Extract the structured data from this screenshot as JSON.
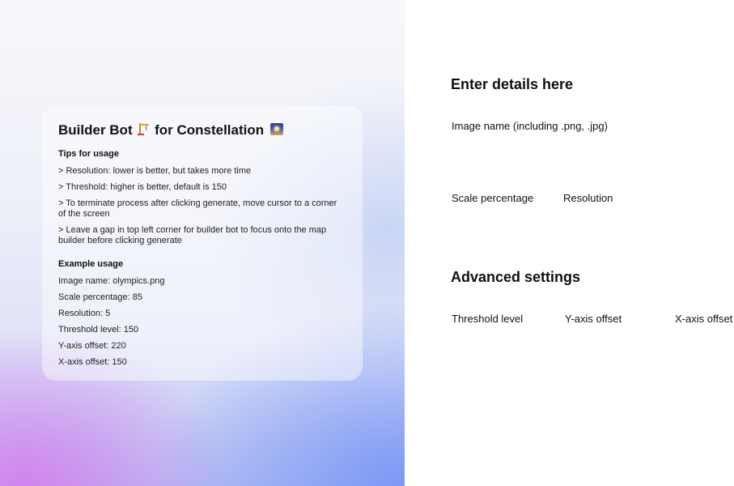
{
  "info": {
    "title_prefix": "Builder Bot",
    "title_suffix": "for Constellation",
    "tips_heading": "Tips for usage",
    "tips": [
      "> Resolution: lower is better, but takes more time",
      "> Threshold: higher is better, default is 150",
      "> To terminate process after clicking generate, move cursor to a corner of the screen",
      "> Leave a gap in top left corner for builder bot to focus onto the map builder before clicking generate"
    ],
    "example_heading": "Example usage",
    "examples": [
      "Image name: olympics.png",
      "Scale percentage: 85",
      "Resolution: 5",
      "Threshold level: 150",
      "Y-axis offset: 220",
      "X-axis offset: 150"
    ]
  },
  "form": {
    "heading": "Enter details here",
    "image_name_label": "Image name (including .png, .jpg)",
    "scale_label": "Scale percentage",
    "resolution_label": "Resolution",
    "advanced_heading": "Advanced settings",
    "threshold_label": "Threshold level",
    "y_offset_label": "Y-axis offset",
    "x_offset_label": "X-axis offset"
  },
  "icons": {
    "title_icon_1": "building-construction-icon",
    "title_icon_2": "night-city-icon"
  }
}
